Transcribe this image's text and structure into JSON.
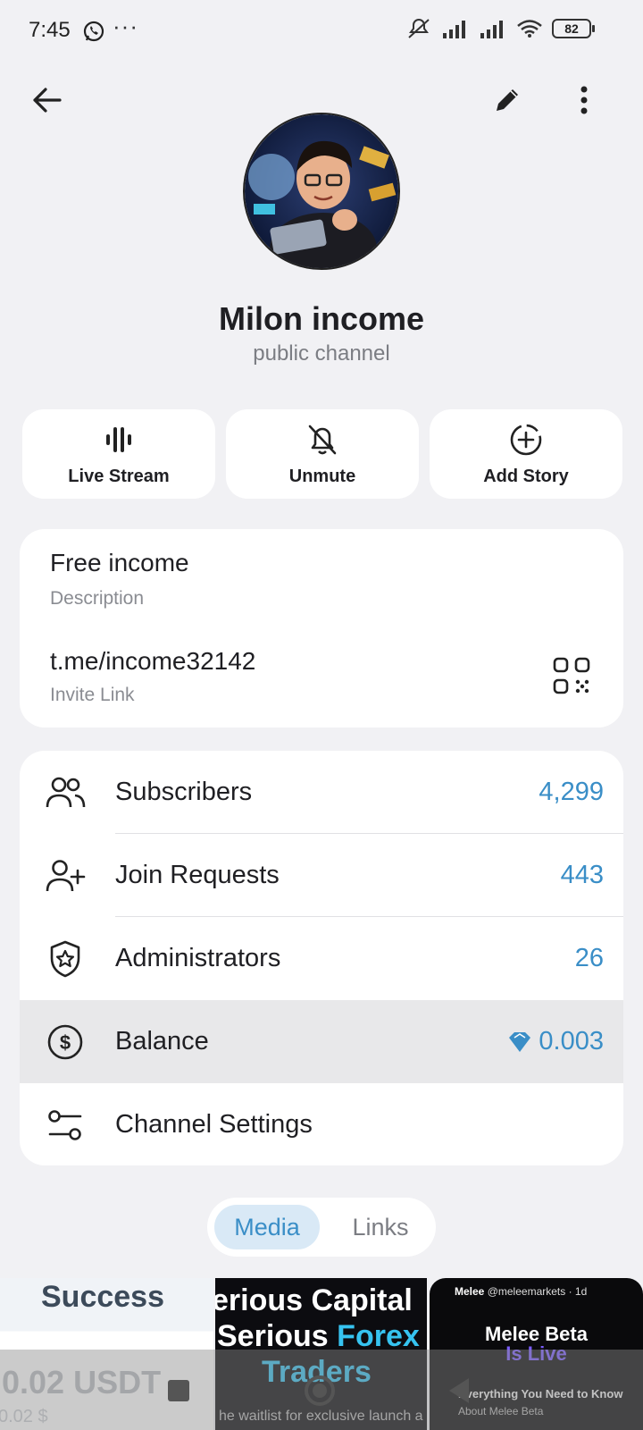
{
  "status_bar": {
    "time": "7:45",
    "dots": "···",
    "battery": "82"
  },
  "profile": {
    "name": "Milon income",
    "type": "public channel"
  },
  "actions": [
    {
      "label": "Live Stream",
      "icon": "live-stream-icon"
    },
    {
      "label": "Unmute",
      "icon": "bell-off-icon"
    },
    {
      "label": "Add Story",
      "icon": "add-story-icon"
    }
  ],
  "info": {
    "description": "Free income",
    "description_label": "Description",
    "link": "t.me/income32142",
    "link_label": "Invite Link"
  },
  "stats": [
    {
      "label": "Subscribers",
      "value": "4,299",
      "icon": "users-icon"
    },
    {
      "label": "Join Requests",
      "value": "443",
      "icon": "user-add-icon"
    },
    {
      "label": "Administrators",
      "value": "26",
      "icon": "shield-star-icon"
    },
    {
      "label": "Balance",
      "value": "0.003",
      "icon": "dollar-circle-icon"
    },
    {
      "label": "Channel Settings",
      "value": "",
      "icon": "settings-sliders-icon"
    }
  ],
  "tabs": {
    "media": "Media",
    "links": "Links"
  },
  "media": {
    "item1": {
      "title": "Success",
      "amount": ".0.02 USDT",
      "sub": "0.02 $"
    },
    "item2": {
      "line1": "erious Capital",
      "line2a": "Serious ",
      "line2b": "Forex",
      "line3": "Traders",
      "line4": "he waitlist for exclusive launch a"
    },
    "item3": {
      "handle_name": "Melee",
      "handle": "@meleemarkets · 1d",
      "title": "Melee Beta",
      "subtitle": "Is Live",
      "text1": "Everything You Need to Know",
      "text2": "About Melee Beta"
    }
  },
  "colors": {
    "accent": "#3a8ec7",
    "background": "#f1f1f4",
    "card": "#ffffff"
  }
}
